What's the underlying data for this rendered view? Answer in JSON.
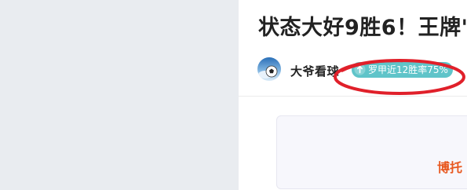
{
  "article": {
    "title": "状态大好9胜6！王牌'",
    "author": {
      "name": "大爷看球",
      "avatar_icon": "soccer-ball-avatar-icon"
    },
    "badge": {
      "icon": "arrow-up-circle-icon",
      "label": "罗甲近12胜率75%",
      "color": "#5fc4c9"
    },
    "preview_card": {
      "text": "博托"
    }
  },
  "annotation": {
    "ring_color": "#e0202a"
  }
}
